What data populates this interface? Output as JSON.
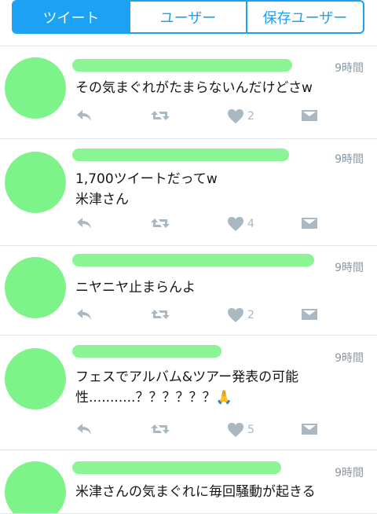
{
  "tabs": [
    {
      "label": "ツイート"
    },
    {
      "label": "ユーザー"
    },
    {
      "label": "保存ユーザー"
    }
  ],
  "tweets": [
    {
      "time": "9時間",
      "text": [
        "その気まぐれがたまらないんだけどさw"
      ],
      "likes": "2"
    },
    {
      "time": "9時間",
      "text": [
        "1,700ツイートだってw",
        "米津さん"
      ],
      "likes": "4"
    },
    {
      "time": "9時間",
      "text": [
        "ニヤニヤ止まらんよ"
      ],
      "likes": "2"
    },
    {
      "time": "9時間",
      "text": [
        "フェスでアルバム&ツアー発表の可能",
        "性...........？？？？？？🙏"
      ],
      "likes": "5"
    },
    {
      "time": "9時間",
      "text": [
        "米津さんの気まぐれに毎回騒動が起きる"
      ],
      "likes": ""
    }
  ],
  "colors": {
    "accent": "#1da1f2",
    "scribble": "#7ef38a",
    "icon": "#aab8c2"
  },
  "icons": [
    "reply-icon",
    "retweet-icon",
    "like-icon",
    "dm-icon"
  ]
}
